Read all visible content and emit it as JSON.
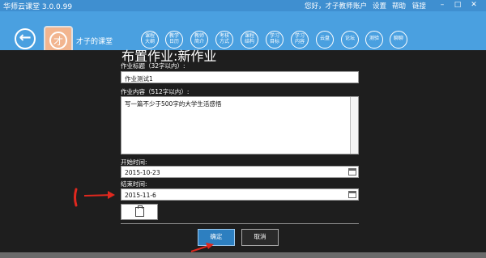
{
  "titlebar": {
    "app_title": "华师云课堂 3.0.0.99",
    "greeting": "您好，才子教师",
    "links": [
      "账户",
      "设置",
      "帮助",
      "链接"
    ],
    "window_controls": [
      "minimize-icon",
      "maximize-icon",
      "close-icon"
    ]
  },
  "header": {
    "course_title": "才子的课堂",
    "avatar_char": "才",
    "nav": [
      {
        "line1": "课程",
        "line2": "大纲"
      },
      {
        "line1": "教学",
        "line2": "日历"
      },
      {
        "line1": "教师",
        "line2": "简介"
      },
      {
        "line1": "考核",
        "line2": "方式"
      },
      {
        "line1": "课程",
        "line2": "结构"
      },
      {
        "line1": "学习",
        "line2": "目标"
      },
      {
        "line1": "学习",
        "line2": "内容"
      },
      {
        "line1": "云盘",
        "line2": ""
      },
      {
        "line1": "论坛",
        "line2": ""
      },
      {
        "line1": "测验",
        "line2": ""
      },
      {
        "line1": "聊聊",
        "line2": ""
      }
    ]
  },
  "form": {
    "heading": "布置作业:新作业",
    "title_label": "作业标题（32字以内）:",
    "title_value": "作业测试1",
    "content_label": "作业内容（512字以内）:",
    "content_value": "写一篇不少于500字的大学生活感悟",
    "start_label": "开始时间:",
    "start_value": "2015-10-23",
    "end_label": "结束时间:",
    "end_value": "2015-11-6",
    "ok_label": "确定",
    "cancel_label": "取消"
  },
  "colors": {
    "titlebar": "#3f8fd0",
    "header": "#4aa0e0",
    "panel": "#1e1e1e",
    "ok_button": "#2d7fc0",
    "annotation": "#e0281e"
  }
}
